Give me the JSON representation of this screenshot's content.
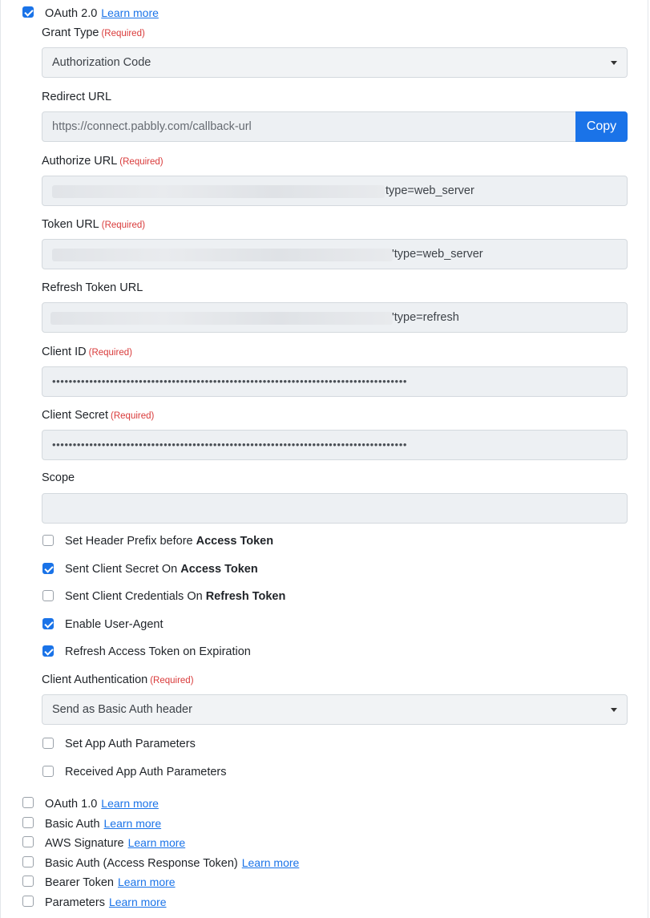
{
  "oauth2": {
    "label": "OAuth 2.0",
    "learn_more": "Learn more",
    "checked": true
  },
  "required_tag": "(Required)",
  "grant_type": {
    "label": "Grant Type",
    "value": "Authorization Code"
  },
  "redirect_url": {
    "label": "Redirect URL",
    "value": "https://connect.pabbly.com/callback-url",
    "copy_label": "Copy"
  },
  "authorize_url": {
    "label": "Authorize URL",
    "visible_tail": "type=web_server"
  },
  "token_url": {
    "label": "Token URL",
    "visible_tail": "'type=web_server"
  },
  "refresh_token_url": {
    "label": "Refresh Token URL",
    "visible_tail": "'type=refresh"
  },
  "client_id": {
    "label": "Client ID",
    "masked_value": "••••••••••••••••••••••••••••••••••••••••••••••••••••••••••••••••••••••••••••••••••••••"
  },
  "client_secret": {
    "label": "Client Secret",
    "masked_value": "••••••••••••••••••••••••••••••••••••••••••••••••••••••••••••••••••••••••••••••••••••••"
  },
  "scope": {
    "label": "Scope",
    "value": ""
  },
  "options": [
    {
      "text": "Set Header Prefix before ",
      "bold": "Access Token",
      "checked": false
    },
    {
      "text": "Sent Client Secret On ",
      "bold": "Access Token",
      "checked": true
    },
    {
      "text": "Sent Client Credentials On ",
      "bold": "Refresh Token",
      "checked": false
    },
    {
      "text": "Enable User-Agent",
      "bold": "",
      "checked": true
    },
    {
      "text": "Refresh Access Token on Expiration",
      "bold": "",
      "checked": true
    }
  ],
  "client_auth": {
    "label": "Client Authentication",
    "value": "Send as Basic Auth header"
  },
  "app_options": [
    {
      "text": "Set App Auth Parameters",
      "checked": false
    },
    {
      "text": "Received App Auth Parameters",
      "checked": false
    }
  ],
  "other_auth": [
    {
      "label": "OAuth 1.0",
      "learn_more": "Learn more",
      "checked": false
    },
    {
      "label": "Basic Auth",
      "learn_more": "Learn more",
      "checked": false
    },
    {
      "label": "AWS Signature",
      "learn_more": "Learn more",
      "checked": false
    },
    {
      "label": "Basic Auth (Access Response Token)",
      "learn_more": "Learn more",
      "checked": false
    },
    {
      "label": "Bearer Token",
      "learn_more": "Learn more",
      "checked": false
    },
    {
      "label": "Parameters",
      "learn_more": "Learn more",
      "checked": false
    }
  ],
  "colors": {
    "accent": "#1a73e8",
    "required": "#d93a3a",
    "input_bg": "#edf0f3"
  }
}
